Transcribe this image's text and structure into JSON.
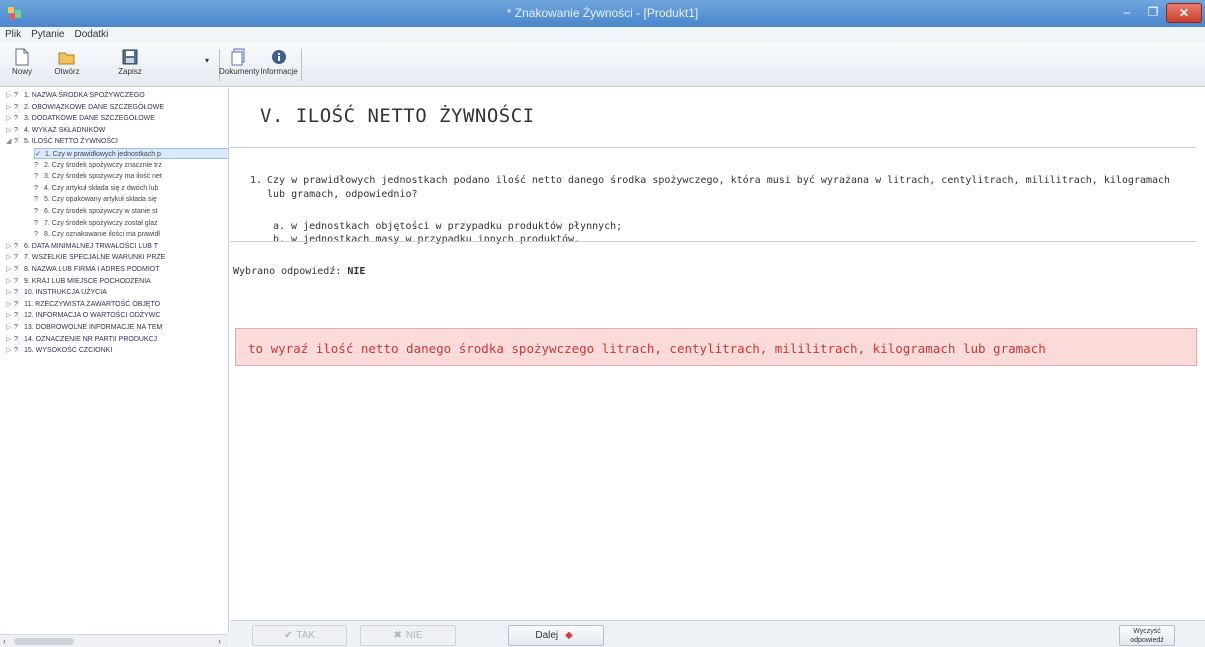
{
  "window": {
    "title": "* Znakowanie Żywności - [Produkt1]",
    "min_glyph": "–",
    "max_glyph": "❐",
    "close_glyph": "✕"
  },
  "menu": [
    "Plik",
    "Pytanie",
    "Dodatki"
  ],
  "toolbar": {
    "new_label": "Nowy",
    "open_label": "Otwórz",
    "save_label": "Zapisz",
    "dropdown_glyph": "▾",
    "docs_label": "Dokumenty",
    "info_label": "Informacje"
  },
  "tree": [
    {
      "label": "1. NAZWA ŚRODKA SPOŻYWCZEGO",
      "exp": "▷",
      "mark": "?",
      "child": false
    },
    {
      "label": "2. OBOWIĄZKOWE DANE SZCZEGÓŁOWE",
      "exp": "▷",
      "mark": "?",
      "child": false
    },
    {
      "label": "3. DODATKOWE DANE SZCZEGÓŁOWE",
      "exp": "▷",
      "mark": "?",
      "child": false
    },
    {
      "label": "4. WYKAZ SKŁADNIKÓW",
      "exp": "▷",
      "mark": "?",
      "child": false
    },
    {
      "label": "5. ILOŚĆ NETTO ŻYWNOŚCI",
      "exp": "◢",
      "mark": "?",
      "child": false
    },
    {
      "label": "1. Czy w prawidłowych jednostkach p",
      "exp": "",
      "mark": "✓",
      "child": true,
      "selected": true
    },
    {
      "label": "2. Czy środek spożywczy znacznie trz",
      "exp": "",
      "mark": "?",
      "child": true
    },
    {
      "label": "3. Czy środek spożywczy ma ilość net",
      "exp": "",
      "mark": "?",
      "child": true
    },
    {
      "label": "4. Czy artykuł składa się z dwóch lub",
      "exp": "",
      "mark": "?",
      "child": true
    },
    {
      "label": "5. Czy opakowany artykuł składa się",
      "exp": "",
      "mark": "?",
      "child": true
    },
    {
      "label": "6. Czy środek spożywczy w stanie st",
      "exp": "",
      "mark": "?",
      "child": true
    },
    {
      "label": "7. Czy środek spożywczy został glaz",
      "exp": "",
      "mark": "?",
      "child": true
    },
    {
      "label": "8. Czy oznakowanie ilości ma prawidł",
      "exp": "",
      "mark": "?",
      "child": true
    },
    {
      "label": "6. DATA MINIMALNEJ TRWAŁOŚCI LUB T",
      "exp": "▷",
      "mark": "?",
      "child": false
    },
    {
      "label": "7. WSZELKIE SPECJALNE WARUNKI PRZE",
      "exp": "▷",
      "mark": "?",
      "child": false
    },
    {
      "label": "8. NAZWA LUB FIRMA I ADRES PODMIOT",
      "exp": "▷",
      "mark": "?",
      "child": false
    },
    {
      "label": "9. KRAJ LUB MIEJSCE POCHODZENIA",
      "exp": "▷",
      "mark": "?",
      "child": false
    },
    {
      "label": "10. INSTRUKCJA UŻYCIA",
      "exp": "▷",
      "mark": "?",
      "child": false
    },
    {
      "label": "11. RZECZYWISTA ZAWARTOŚĆ OBJĘTO",
      "exp": "▷",
      "mark": "?",
      "child": false
    },
    {
      "label": "12. INFORMACJA O WARTOŚCI ODŻYWC",
      "exp": "▷",
      "mark": "?",
      "child": false
    },
    {
      "label": "13. DOBROWOLNE INFORMACJE NA TEM",
      "exp": "▷",
      "mark": "?",
      "child": false
    },
    {
      "label": "14. OZNACZENIE NR PARTII PRODUKCJ",
      "exp": "▷",
      "mark": "?",
      "child": false
    },
    {
      "label": "15. WYSOKOŚĆ CZCIONKI",
      "exp": "▷",
      "mark": "?",
      "child": false
    }
  ],
  "tree_scroll": {
    "left_arrow": "‹",
    "right_arrow": "›"
  },
  "main": {
    "heading": "V. ILOŚĆ NETTO ŻYWNOŚCI",
    "question_number": "1.",
    "question_text": "Czy w prawidłowych jednostkach podano ilość netto danego środka spożywczego, która musi być wyrażana w litrach, centylitrach, mililitrach, kilogramach lub gramach, odpowiednio?",
    "option_a": "a.  w jednostkach objętości w przypadku produktów płynnych;",
    "option_b": "b.  w jednostkach masy w przypadku innych produktów.",
    "answer_prefix": "Wybrano odpowiedź: ",
    "answer_value": "NIE",
    "alert_text": "to wyraź ilość netto danego środka spożywczego litrach, centylitrach, mililitrach, kilogramach lub gramach"
  },
  "bottom": {
    "yes_label": "TAK",
    "no_label": "NIE",
    "next_label": "Dalej",
    "clear_label_1": "Wyczyść",
    "clear_label_2": "odpowiedź"
  },
  "colors": {
    "alert_bg": "#fbdada",
    "alert_text": "#c43b3b",
    "titlebar": "#4a86cc",
    "close_button": "#c8402c"
  }
}
